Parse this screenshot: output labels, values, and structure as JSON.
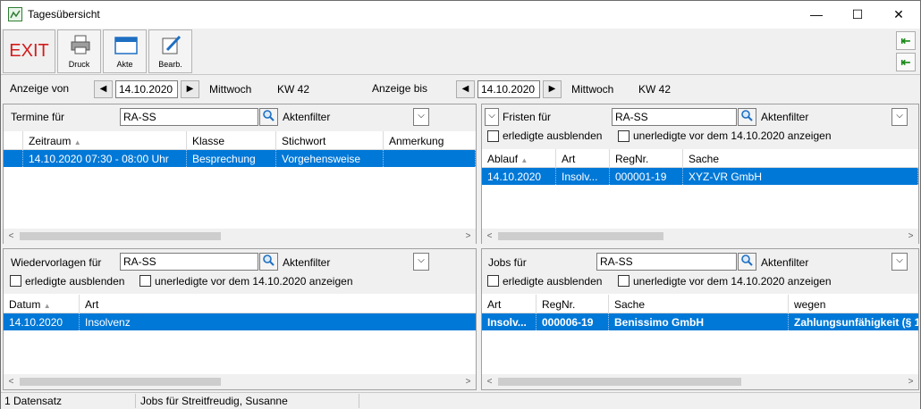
{
  "window": {
    "title": "Tagesübersicht",
    "min": "—",
    "max": "☐",
    "close": "✕"
  },
  "toolbar": {
    "exit": "EXIT",
    "print": "Druck",
    "file": "Akte",
    "edit": "Bearb."
  },
  "datebar": {
    "from_label": "Anzeige von",
    "from_date": "14.10.2020",
    "from_day": "Mittwoch",
    "from_week": "KW 42",
    "to_label": "Anzeige bis",
    "to_date": "14.10.2020",
    "to_day": "Mittwoch",
    "to_week": "KW 42"
  },
  "termine": {
    "label": "Termine für",
    "user": "RA-SS",
    "filter": "Aktenfilter",
    "columns": [
      "Zeitraum",
      "Klasse",
      "Stichwort",
      "Anmerkung"
    ],
    "rows": [
      [
        "14.10.2020 07:30 - 08:00 Uhr",
        "Besprechung",
        "Vorgehensweise",
        ""
      ]
    ]
  },
  "fristen": {
    "label": "Fristen für",
    "user": "RA-SS",
    "filter": "Aktenfilter",
    "cb_done": "erledigte ausblenden",
    "cb_open": "unerledigte vor dem 14.10.2020 anzeigen",
    "columns": [
      "Ablauf",
      "Art",
      "RegNr.",
      "Sache"
    ],
    "rows": [
      [
        "14.10.2020",
        "Insolv...",
        "000001-19",
        "XYZ-VR GmbH"
      ]
    ]
  },
  "wiedervorlagen": {
    "label": "Wiedervorlagen für",
    "user": "RA-SS",
    "filter": "Aktenfilter",
    "cb_done": "erledigte ausblenden",
    "cb_open": "unerledigte vor dem 14.10.2020 anzeigen",
    "columns": [
      "Datum",
      "Art"
    ],
    "rows": [
      [
        "14.10.2020",
        "Insolvenz"
      ]
    ]
  },
  "jobs": {
    "label": "Jobs für",
    "user": "RA-SS",
    "filter": "Aktenfilter",
    "cb_done": "erledigte ausblenden",
    "cb_open": "unerledigte vor dem 14.10.2020 anzeigen",
    "columns": [
      "Art",
      "RegNr.",
      "Sache",
      "wegen"
    ],
    "rows": [
      [
        "Insolv...",
        "000006-19",
        "Benissimo GmbH",
        "Zahlungsunfähigkeit (§ 1"
      ]
    ]
  },
  "status": {
    "count": "1 Datensatz",
    "info": "Jobs für Streitfreudig, Susanne"
  }
}
